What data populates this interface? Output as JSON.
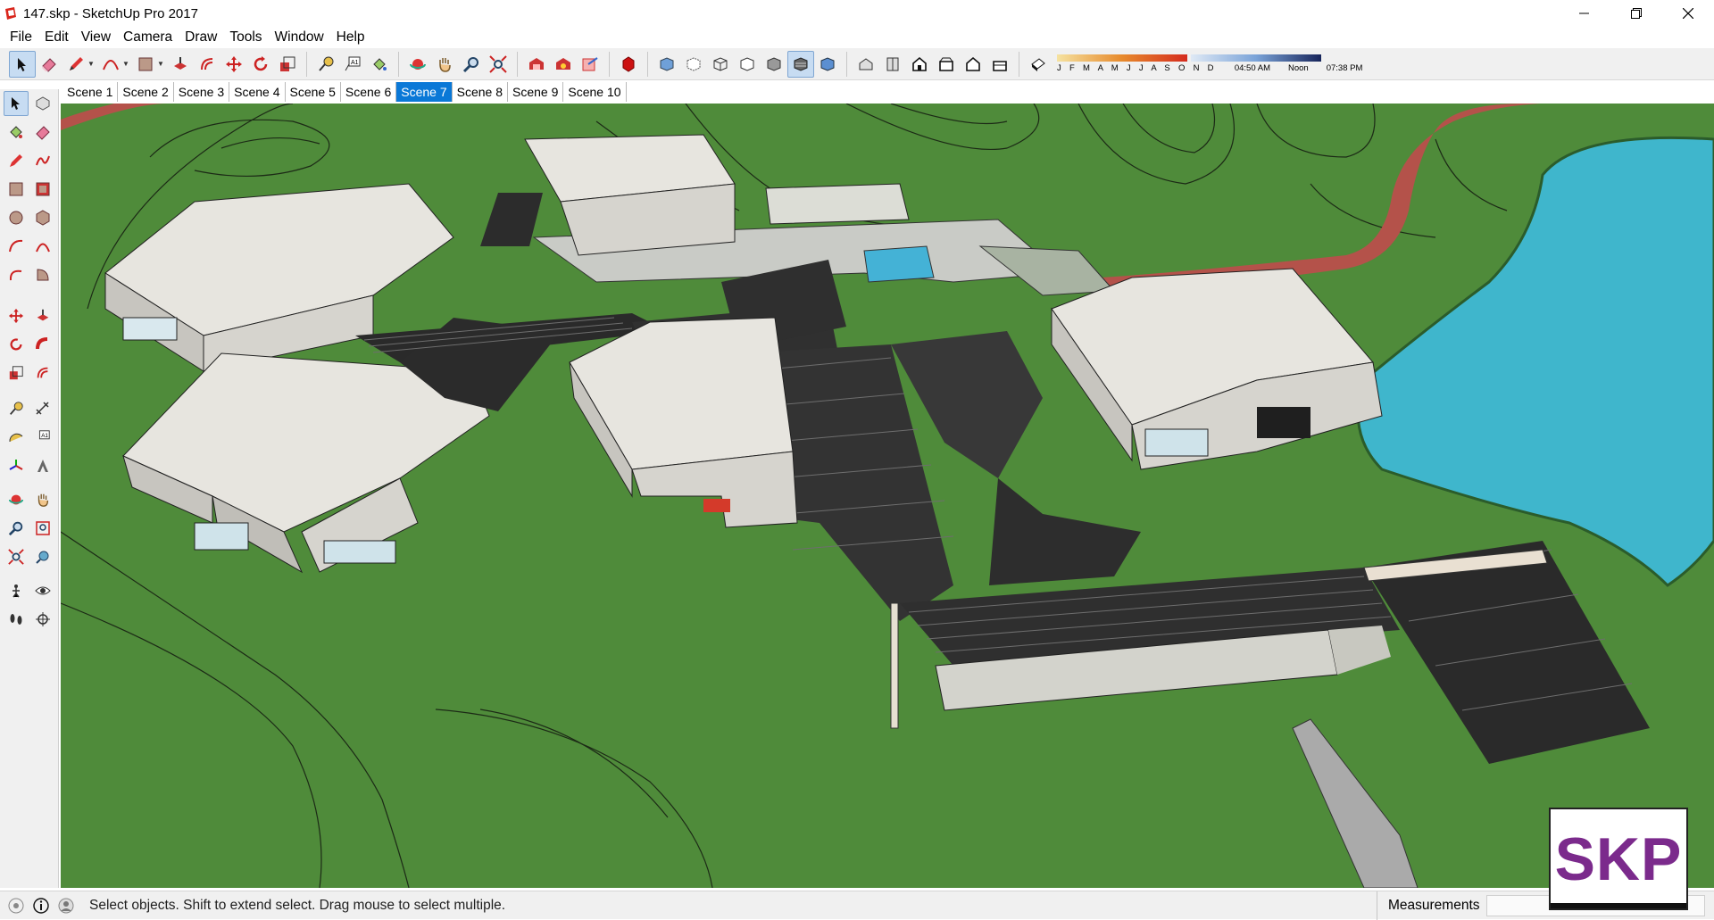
{
  "window": {
    "title": "147.skp - SketchUp Pro 2017"
  },
  "menu": [
    "File",
    "Edit",
    "View",
    "Camera",
    "Draw",
    "Tools",
    "Window",
    "Help"
  ],
  "scenes": {
    "tabs": [
      "Scene 1",
      "Scene 2",
      "Scene 3",
      "Scene 4",
      "Scene 5",
      "Scene 6",
      "Scene 7",
      "Scene 8",
      "Scene 9",
      "Scene 10"
    ],
    "active": "Scene 7"
  },
  "shadow": {
    "months": "J F M A M J J A S O N D",
    "time_start": "04:50 AM",
    "time_mid": "Noon",
    "time_end": "07:38 PM"
  },
  "status": {
    "hint": "Select objects. Shift to extend select. Drag mouse to select multiple.",
    "measurements_label": "Measurements",
    "measurements_value": ""
  },
  "logo": {
    "text": "SKP"
  },
  "colors": {
    "grass": "#4e8a3a",
    "water": "#3fb6cc",
    "path": "#b4524a",
    "roof": "#e8e6e0",
    "pergola": "#2b2b2b",
    "active_tab": "#0a78d7",
    "logo_text": "#7b2a8c"
  }
}
